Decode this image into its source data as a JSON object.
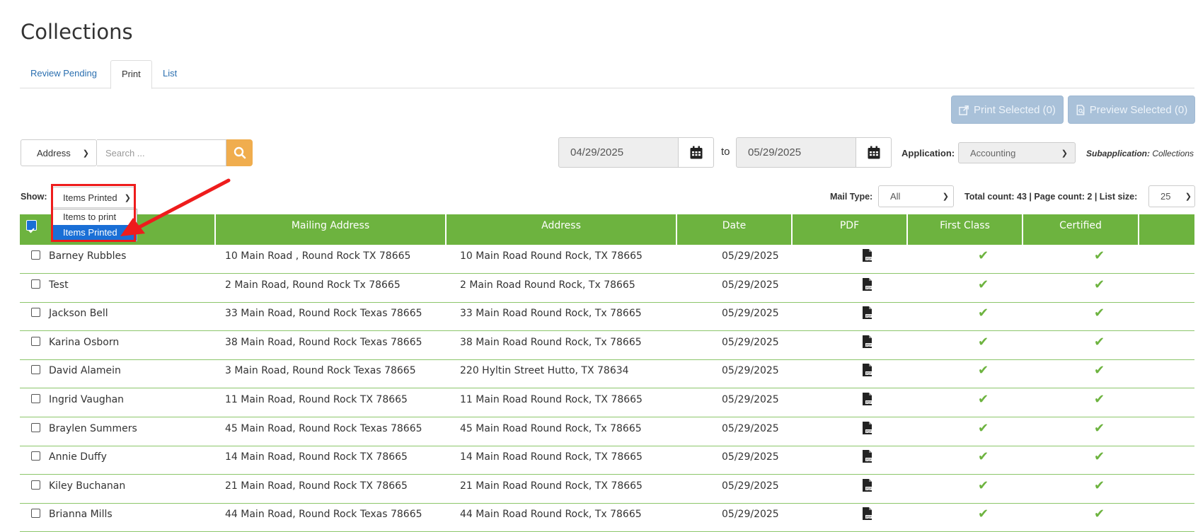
{
  "page": {
    "title": "Collections"
  },
  "tabs": [
    {
      "label": "Review Pending",
      "active": false
    },
    {
      "label": "Print",
      "active": true
    },
    {
      "label": "List",
      "active": false
    }
  ],
  "actions": {
    "print_selected": "Print Selected (0)",
    "preview_selected": "Preview Selected (0)"
  },
  "search": {
    "field_select": "Address",
    "placeholder": "Search ...",
    "value": ""
  },
  "date_range": {
    "from": "04/29/2025",
    "to_label": "to",
    "to": "05/29/2025"
  },
  "application": {
    "label": "Application:",
    "value": "Accounting"
  },
  "subapplication": {
    "label": "Subapplication:",
    "value": "Collections"
  },
  "show": {
    "label": "Show:",
    "value": "Items Printed",
    "options": [
      "Items to print",
      "Items Printed"
    ],
    "highlighted_option": "Items Printed"
  },
  "mail_type": {
    "label": "Mail Type:",
    "value": "All"
  },
  "counts": {
    "text": "Total count: 43 | Page count: 2 | List size:",
    "list_size": "25"
  },
  "table": {
    "columns": [
      "",
      "Mailing Address",
      "Address",
      "Date",
      "PDF",
      "First Class",
      "Certified",
      ""
    ],
    "rows": [
      {
        "name": "Barney Rubbles",
        "mailing": "10 Main Road , Round Rock TX 78665",
        "address": "10 Main Road Round Rock, TX 78665",
        "date": "05/29/2025"
      },
      {
        "name": "Test",
        "mailing": "2 Main Road, Round Rock Tx 78665",
        "address": "2 Main Road Round Rock, Tx 78665",
        "date": "05/29/2025"
      },
      {
        "name": "Jackson Bell",
        "mailing": "33 Main Road, Round Rock Texas 78665",
        "address": "33 Main Road Round Rock, Tx 78665",
        "date": "05/29/2025"
      },
      {
        "name": "Karina Osborn",
        "mailing": "38 Main Road, Round Rock Texas 78665",
        "address": "38 Main Road Round Rock, Tx 78665",
        "date": "05/29/2025"
      },
      {
        "name": "David Alamein",
        "mailing": "3 Main Road, Round Rock Texas 78665",
        "address": "220 Hyltin Street Hutto, TX 78634",
        "date": "05/29/2025"
      },
      {
        "name": "Ingrid Vaughan",
        "mailing": "11 Main Road, Round Rock TX 78665",
        "address": "11 Main Road Round Rock, TX 78665",
        "date": "05/29/2025"
      },
      {
        "name": "Braylen Summers",
        "mailing": "45 Main Road, Round Rock Texas 78665",
        "address": "45 Main Road Round Rock, Tx 78665",
        "date": "05/29/2025"
      },
      {
        "name": "Annie Duffy",
        "mailing": "14 Main Road, Round Rock TX 78665",
        "address": "14 Main Road Round Rock, TX 78665",
        "date": "05/29/2025"
      },
      {
        "name": "Kiley Buchanan",
        "mailing": "21 Main Road, Round Rock TX 78665",
        "address": "21 Main Road Round Rock, TX 78665",
        "date": "05/29/2025"
      },
      {
        "name": "Brianna Mills",
        "mailing": "44 Main Road, Round Rock Texas 78665",
        "address": "44 Main Road Round Rock, Tx 78665",
        "date": "05/29/2025"
      }
    ]
  },
  "colors": {
    "header_green": "#6db33f",
    "accent_orange": "#f0ad4e",
    "annotation_red": "#ee1c1c",
    "selected_blue": "#1a6fd6"
  },
  "icons": {
    "search": "search-icon",
    "calendar": "calendar-icon",
    "pdf": "pdf-icon",
    "check": "check-icon"
  }
}
